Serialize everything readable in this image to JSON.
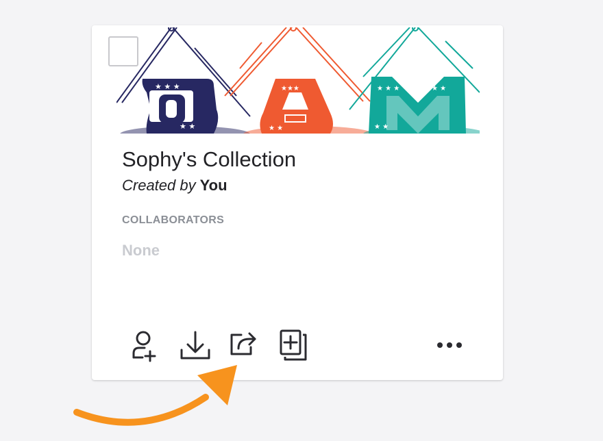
{
  "collection": {
    "title": "Sophy's Collection",
    "created_prefix": "Created by",
    "created_by": "You",
    "collaborators_label": "COLLABORATORS",
    "collaborators_value": "None"
  },
  "actions": [
    {
      "icon": "add-collaborator-icon"
    },
    {
      "icon": "download-icon"
    },
    {
      "icon": "share-icon"
    },
    {
      "icon": "duplicate-icon"
    },
    {
      "icon": "more-options-icon"
    }
  ],
  "colors": {
    "navy": "#272862",
    "orange": "#ef5a31",
    "teal": "#12a89a",
    "annotation_arrow": "#f7931e",
    "icon": "#2b2b30"
  }
}
